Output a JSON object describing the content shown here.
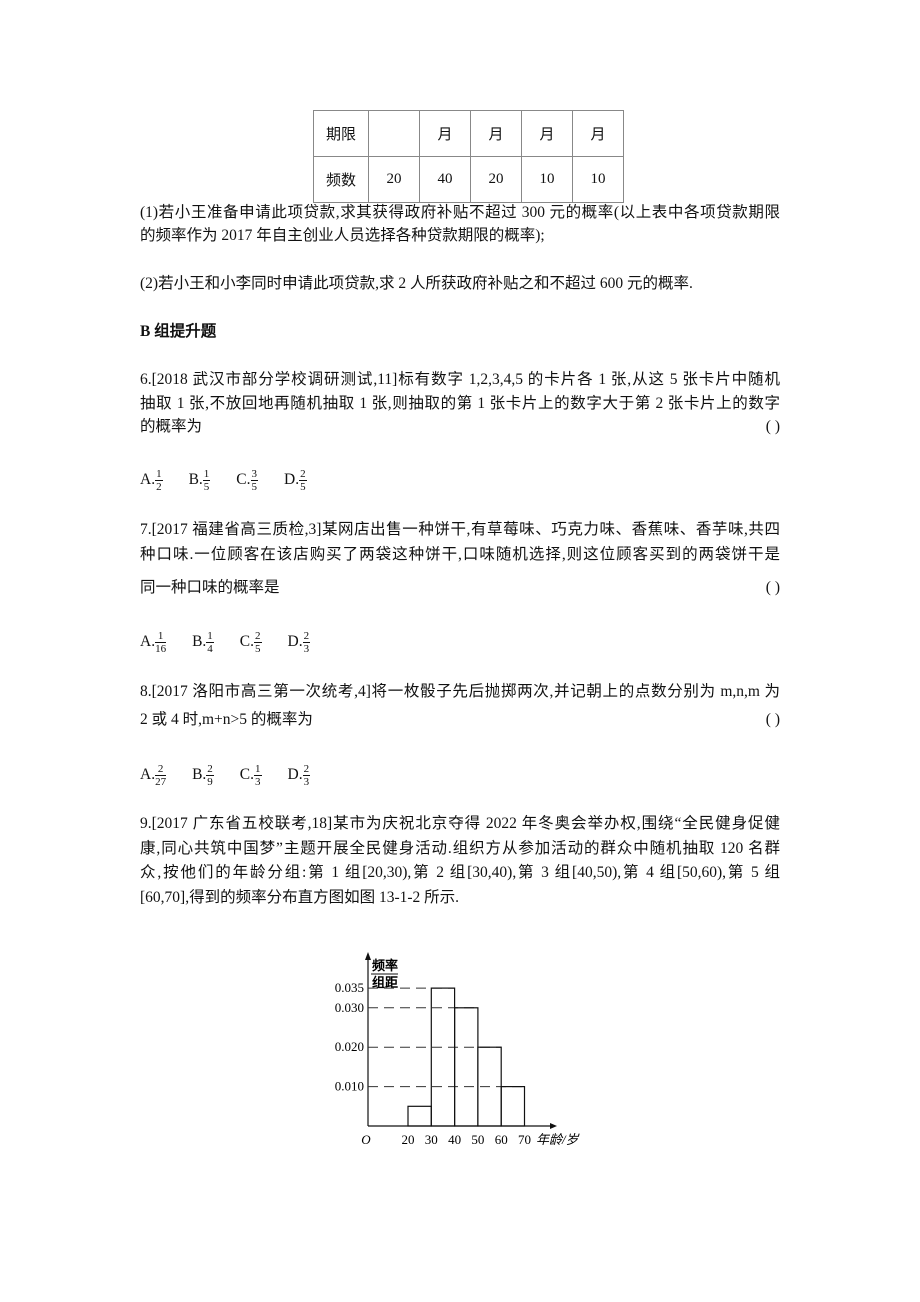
{
  "table": {
    "rows": [
      [
        "期限",
        "",
        "月",
        "月",
        "月",
        "月"
      ],
      [
        "频数",
        "20",
        "40",
        "20",
        "10",
        "10"
      ]
    ]
  },
  "q5": {
    "lines": [
      "(1)若小王准备申请此项贷款,求其获得政府补贴不超过 300 元的概率(以上表中各项贷款期限",
      "的频率作为 2017 年自主创业人员选择各种贷款期限的概率);",
      "(2)若小王和小李同时申请此项贷款,求 2 人所获政府补贴之和不超过 600 元的概率."
    ]
  },
  "section": "B 组提升题",
  "q6": {
    "lines": [
      "6.[2018 武汉市部分学校调研测试,11]标有数字 1,2,3,4,5 的卡片各 1 张,从这 5 张卡片中随机",
      "抽取 1 张,不放回地再随机抽取 1 张,则抽取的第 1 张卡片上的数字大于第 2 张卡片上的数字",
      "的概率为"
    ],
    "paren": "(      )",
    "options": [
      {
        "l": "A.",
        "n": "1",
        "d": "2"
      },
      {
        "l": "B.",
        "n": "1",
        "d": "5"
      },
      {
        "l": "C.",
        "n": "3",
        "d": "5"
      },
      {
        "l": "D.",
        "n": "2",
        "d": "5"
      }
    ]
  },
  "q7": {
    "lines": [
      "7.[2017 福建省高三质检,3]某网店出售一种饼干,有草莓味、巧克力味、香蕉味、香芋味,共四",
      "种口味.一位顾客在该店购买了两袋这种饼干,口味随机选择,则这位顾客买到的两袋饼干是",
      "同一种口味的概率是"
    ],
    "paren": "(      )",
    "options": [
      {
        "l": "A.",
        "n": "1",
        "d": "16"
      },
      {
        "l": "B.",
        "n": "1",
        "d": "4"
      },
      {
        "l": "C.",
        "n": "2",
        "d": "5"
      },
      {
        "l": "D.",
        "n": "2",
        "d": "3"
      }
    ]
  },
  "q8": {
    "lines": [
      "8.[2017 洛阳市高三第一次统考,4]将一枚骰子先后抛掷两次,并记朝上的点数分别为 m,n,m 为",
      "2 或 4 时,m+n>5 的概率为"
    ],
    "paren": "(      )",
    "options": [
      {
        "l": "A.",
        "n": "2",
        "d": "27"
      },
      {
        "l": "B.",
        "n": "2",
        "d": "9"
      },
      {
        "l": "C.",
        "n": "1",
        "d": "3"
      },
      {
        "l": "D.",
        "n": "2",
        "d": "3"
      }
    ]
  },
  "q9": {
    "lines": [
      "9.[2017 广东省五校联考,18]某市为庆祝北京夺得 2022 年冬奥会举办权,围绕“全民健身促健",
      "康,同心共筑中国梦”主题开展全民健身活动.组织方从参加活动的群众中随机抽取 120 名群",
      "众,按他们的年龄分组:第 1 组[20,30),第 2 组[30,40),第 3 组[40,50),第 4 组[50,60),第 5 组",
      "[60,70],得到的频率分布直方图如图 13-1-2 所示."
    ]
  },
  "chart_data": {
    "type": "bar",
    "subtype": "histogram",
    "ylabel_num": "频率",
    "ylabel_den": "组距",
    "xlabel": "年龄/岁",
    "origin": "O",
    "bins": [
      [
        20,
        30
      ],
      [
        30,
        40
      ],
      [
        40,
        50
      ],
      [
        50,
        60
      ],
      [
        60,
        70
      ]
    ],
    "values": [
      0.005,
      0.035,
      0.03,
      0.02,
      0.01
    ],
    "xticks": [
      "20",
      "30",
      "40",
      "50",
      "60",
      "70"
    ],
    "yticks": [
      "0.010",
      "0.020",
      "0.030",
      "0.035"
    ],
    "ytick_values": [
      0.01,
      0.02,
      0.03,
      0.035
    ],
    "grid": "dashed reference lines at labeled ticks"
  }
}
